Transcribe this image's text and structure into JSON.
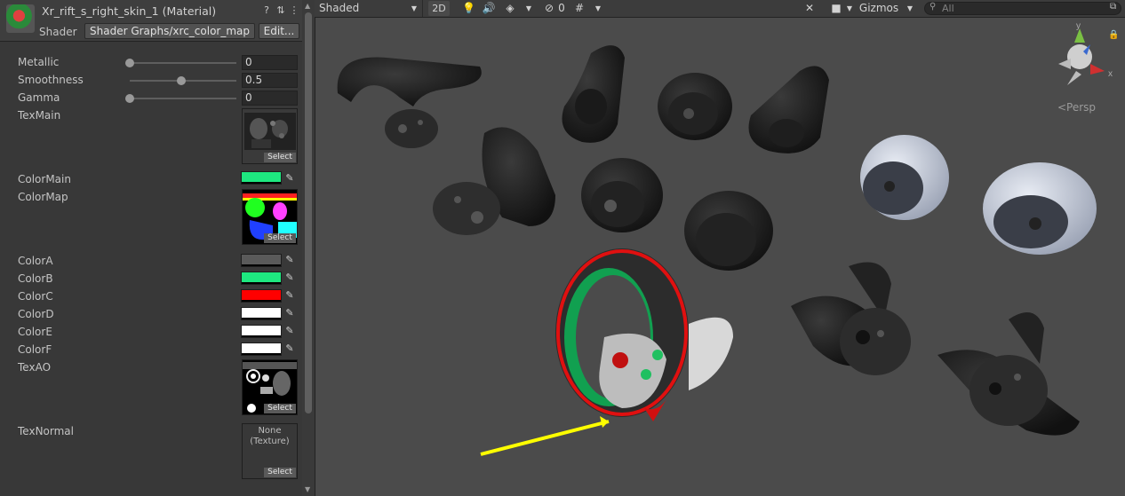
{
  "inspector": {
    "title": "Xr_rift_s_right_skin_1 (Material)",
    "header_icons": [
      "help-icon",
      "preset-icon",
      "more-icon"
    ],
    "shader_label": "Shader",
    "shader_value": "Shader Graphs/xrc_color_map",
    "edit_label": "Edit...",
    "metallic": {
      "label": "Metallic",
      "value": "0",
      "slider_fraction": 0
    },
    "smoothness": {
      "label": "Smoothness",
      "value": "0.5",
      "slider_fraction": 0.5
    },
    "gamma": {
      "label": "Gamma",
      "value": "0",
      "slider_fraction": 0
    },
    "texmain": {
      "label": "TexMain",
      "select": "Select"
    },
    "colormain": {
      "label": "ColorMain",
      "color": "#1ee880"
    },
    "colormap": {
      "label": "ColorMap",
      "select": "Select"
    },
    "colors": [
      {
        "label": "ColorA",
        "color": "#5a5a5a"
      },
      {
        "label": "ColorB",
        "color": "#1ee880"
      },
      {
        "label": "ColorC",
        "color": "#ff0000"
      },
      {
        "label": "ColorD",
        "color": "#ffffff"
      },
      {
        "label": "ColorE",
        "color": "#ffffff"
      },
      {
        "label": "ColorF",
        "color": "#ffffff"
      }
    ],
    "texao": {
      "label": "TexAO",
      "select": "Select"
    },
    "texnormal": {
      "label": "TexNormal",
      "none_line1": "None",
      "none_line2": "(Texture)",
      "select": "Select"
    }
  },
  "scene": {
    "draw_mode": "Shaded",
    "mode_2d": "2D",
    "hidden_count": "0",
    "gizmos_label": "Gizmos",
    "search_placeholder": "All",
    "projection_label": "<Persp",
    "accent_yellow": "#ffff00"
  }
}
